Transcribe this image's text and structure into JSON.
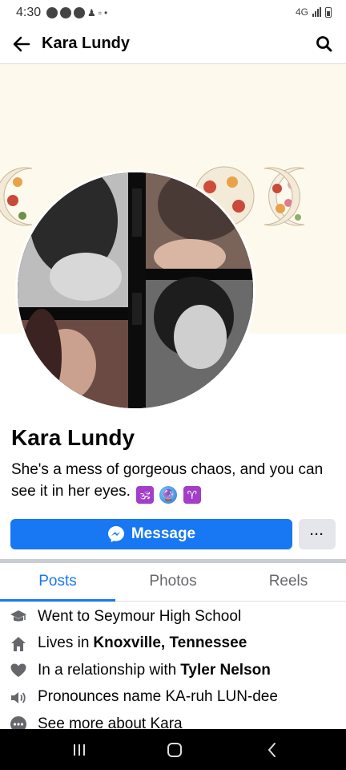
{
  "status_bar": {
    "time": "4:30",
    "network": "4G",
    "indicator_dot": "•"
  },
  "header": {
    "title": "Kara Lundy",
    "back_icon": "arrow-left-icon",
    "search_icon": "search-icon"
  },
  "profile": {
    "name": "Kara Lundy",
    "bio": "She's a mess of gorgeous chaos, and you can see it in her eyes.",
    "bio_emojis": [
      "🕉",
      "🔮",
      "♈"
    ]
  },
  "actions": {
    "message_label": "Message",
    "more_label": "···"
  },
  "tabs": [
    {
      "label": "Posts",
      "active": true
    },
    {
      "label": "Photos",
      "active": false
    },
    {
      "label": "Reels",
      "active": false
    }
  ],
  "intro": [
    {
      "icon": "graduation-cap-icon",
      "text": "Went to Seymour High School",
      "bold": ""
    },
    {
      "icon": "home-icon",
      "text": "Lives in",
      "bold": "Knoxville, Tennessee"
    },
    {
      "icon": "heart-icon",
      "text": "In a relationship with",
      "bold": "Tyler Nelson"
    },
    {
      "icon": "speaker-icon",
      "text": "Pronounces name KA-ruh LUN-dee",
      "bold": ""
    },
    {
      "icon": "more-dots-icon",
      "text": "See more about Kara",
      "bold": ""
    }
  ],
  "colors": {
    "accent": "#1877f2",
    "cover_background": "#fdf9ec",
    "secondary_button": "#e4e6eb"
  }
}
